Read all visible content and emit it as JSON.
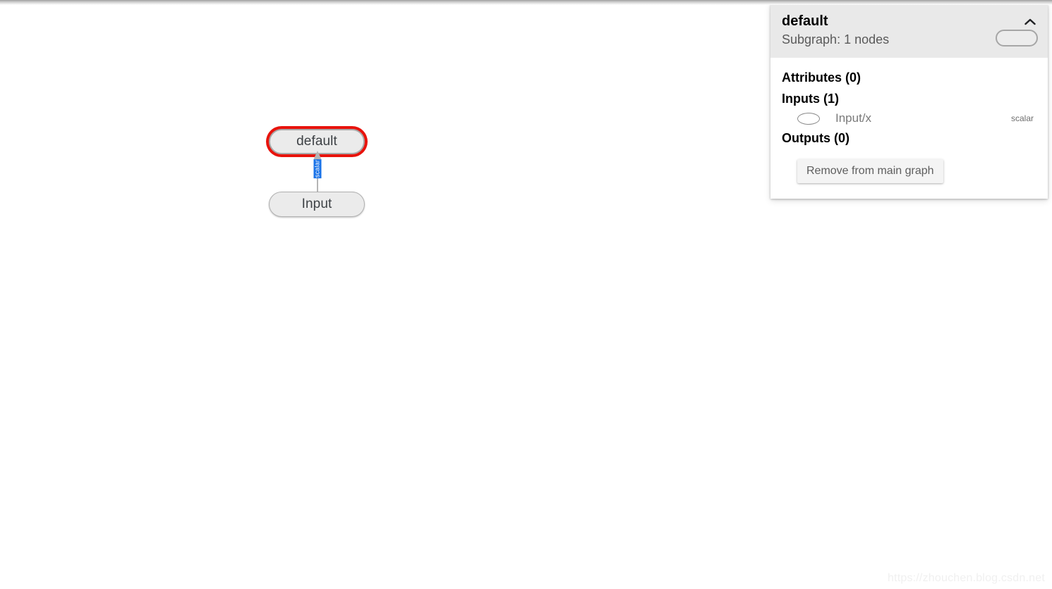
{
  "graph": {
    "nodes": [
      {
        "id": "default",
        "label": "default",
        "type": "subgraph-node",
        "selected": true
      },
      {
        "id": "input",
        "label": "Input",
        "type": "op-node",
        "selected": false
      }
    ],
    "edges": [
      {
        "from": "Input",
        "to": "default",
        "label": "scalar",
        "highlighted": true
      }
    ]
  },
  "info_card": {
    "title": "default",
    "subtitle": "Subgraph: 1 nodes",
    "collapse_icon": "chevron-up-icon",
    "shape_legend_icon": "rounded-rect-node-icon",
    "sections": {
      "attributes": {
        "heading": "Attributes (0)",
        "count": 0,
        "items": []
      },
      "inputs": {
        "heading": "Inputs (1)",
        "count": 1,
        "items": [
          {
            "icon": "ellipse-node-icon",
            "name": "Input/x",
            "shape": "scalar"
          }
        ]
      },
      "outputs": {
        "heading": "Outputs (0)",
        "count": 0,
        "items": []
      }
    },
    "remove_button": "Remove from main graph"
  },
  "watermark": "https://zhouchen.blog.csdn.net",
  "colors": {
    "selection_red": "#e8130c",
    "node_fill": "#ebebeb",
    "node_stroke": "#a8a8a8",
    "edge_label_highlight": "#1a73e8",
    "header_bg": "#e9e9e9",
    "canvas_bg": "#ffffff"
  }
}
